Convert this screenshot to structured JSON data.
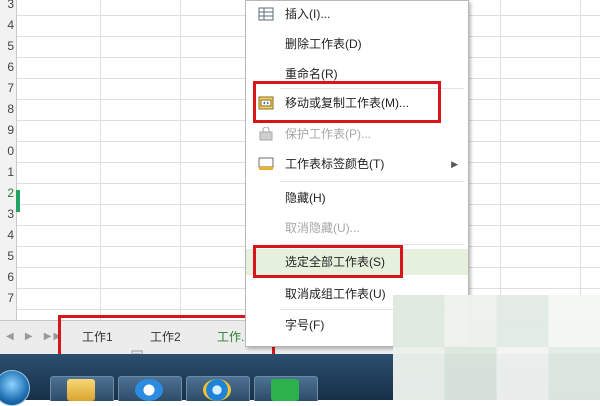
{
  "sheet": {
    "row_numbers": [
      "3",
      "4",
      "5",
      "6",
      "7",
      "8",
      "9",
      "0",
      "1",
      "2",
      "3",
      "4",
      "5",
      "6",
      "7"
    ],
    "active_row_index": 9
  },
  "tabs": {
    "nav": [
      "◀",
      "▶",
      "▶▶"
    ],
    "items": [
      {
        "label": "工作1",
        "active": false
      },
      {
        "label": "工作2",
        "active": false
      },
      {
        "label": "工作...",
        "active": true
      }
    ]
  },
  "context_menu": {
    "items": [
      {
        "label": "插入(I)...",
        "icon": "insert-sheet-icon",
        "disabled": false
      },
      {
        "label": "删除工作表(D)",
        "icon": "",
        "disabled": false
      },
      {
        "label": "重命名(R)",
        "icon": "",
        "disabled": false
      },
      {
        "label": "移动或复制工作表(M)...",
        "icon": "move-copy-sheet-icon",
        "disabled": false
      },
      {
        "label": "保护工作表(P)...",
        "icon": "protect-sheet-icon",
        "disabled": true
      },
      {
        "label": "工作表标签颜色(T)",
        "icon": "tab-color-icon",
        "disabled": false,
        "submenu": true
      },
      {
        "label": "隐藏(H)",
        "icon": "",
        "disabled": false
      },
      {
        "label": "取消隐藏(U)...",
        "icon": "",
        "disabled": true
      },
      {
        "label": "选定全部工作表(S)",
        "icon": "",
        "disabled": false,
        "highlighted": true
      },
      {
        "label": "取消成组工作表(U)",
        "icon": "",
        "disabled": false
      },
      {
        "label": "字号(F)",
        "icon": "",
        "disabled": false
      }
    ]
  },
  "taskbar": {
    "items": [
      "start-orb",
      "folder-app",
      "sogou-app",
      "ie-app",
      "wps-sheet-app"
    ]
  },
  "colors": {
    "highlight_box": "#d9141b",
    "active_tab": "#2e7d32",
    "menu_highlight": "#e6f1dd"
  }
}
